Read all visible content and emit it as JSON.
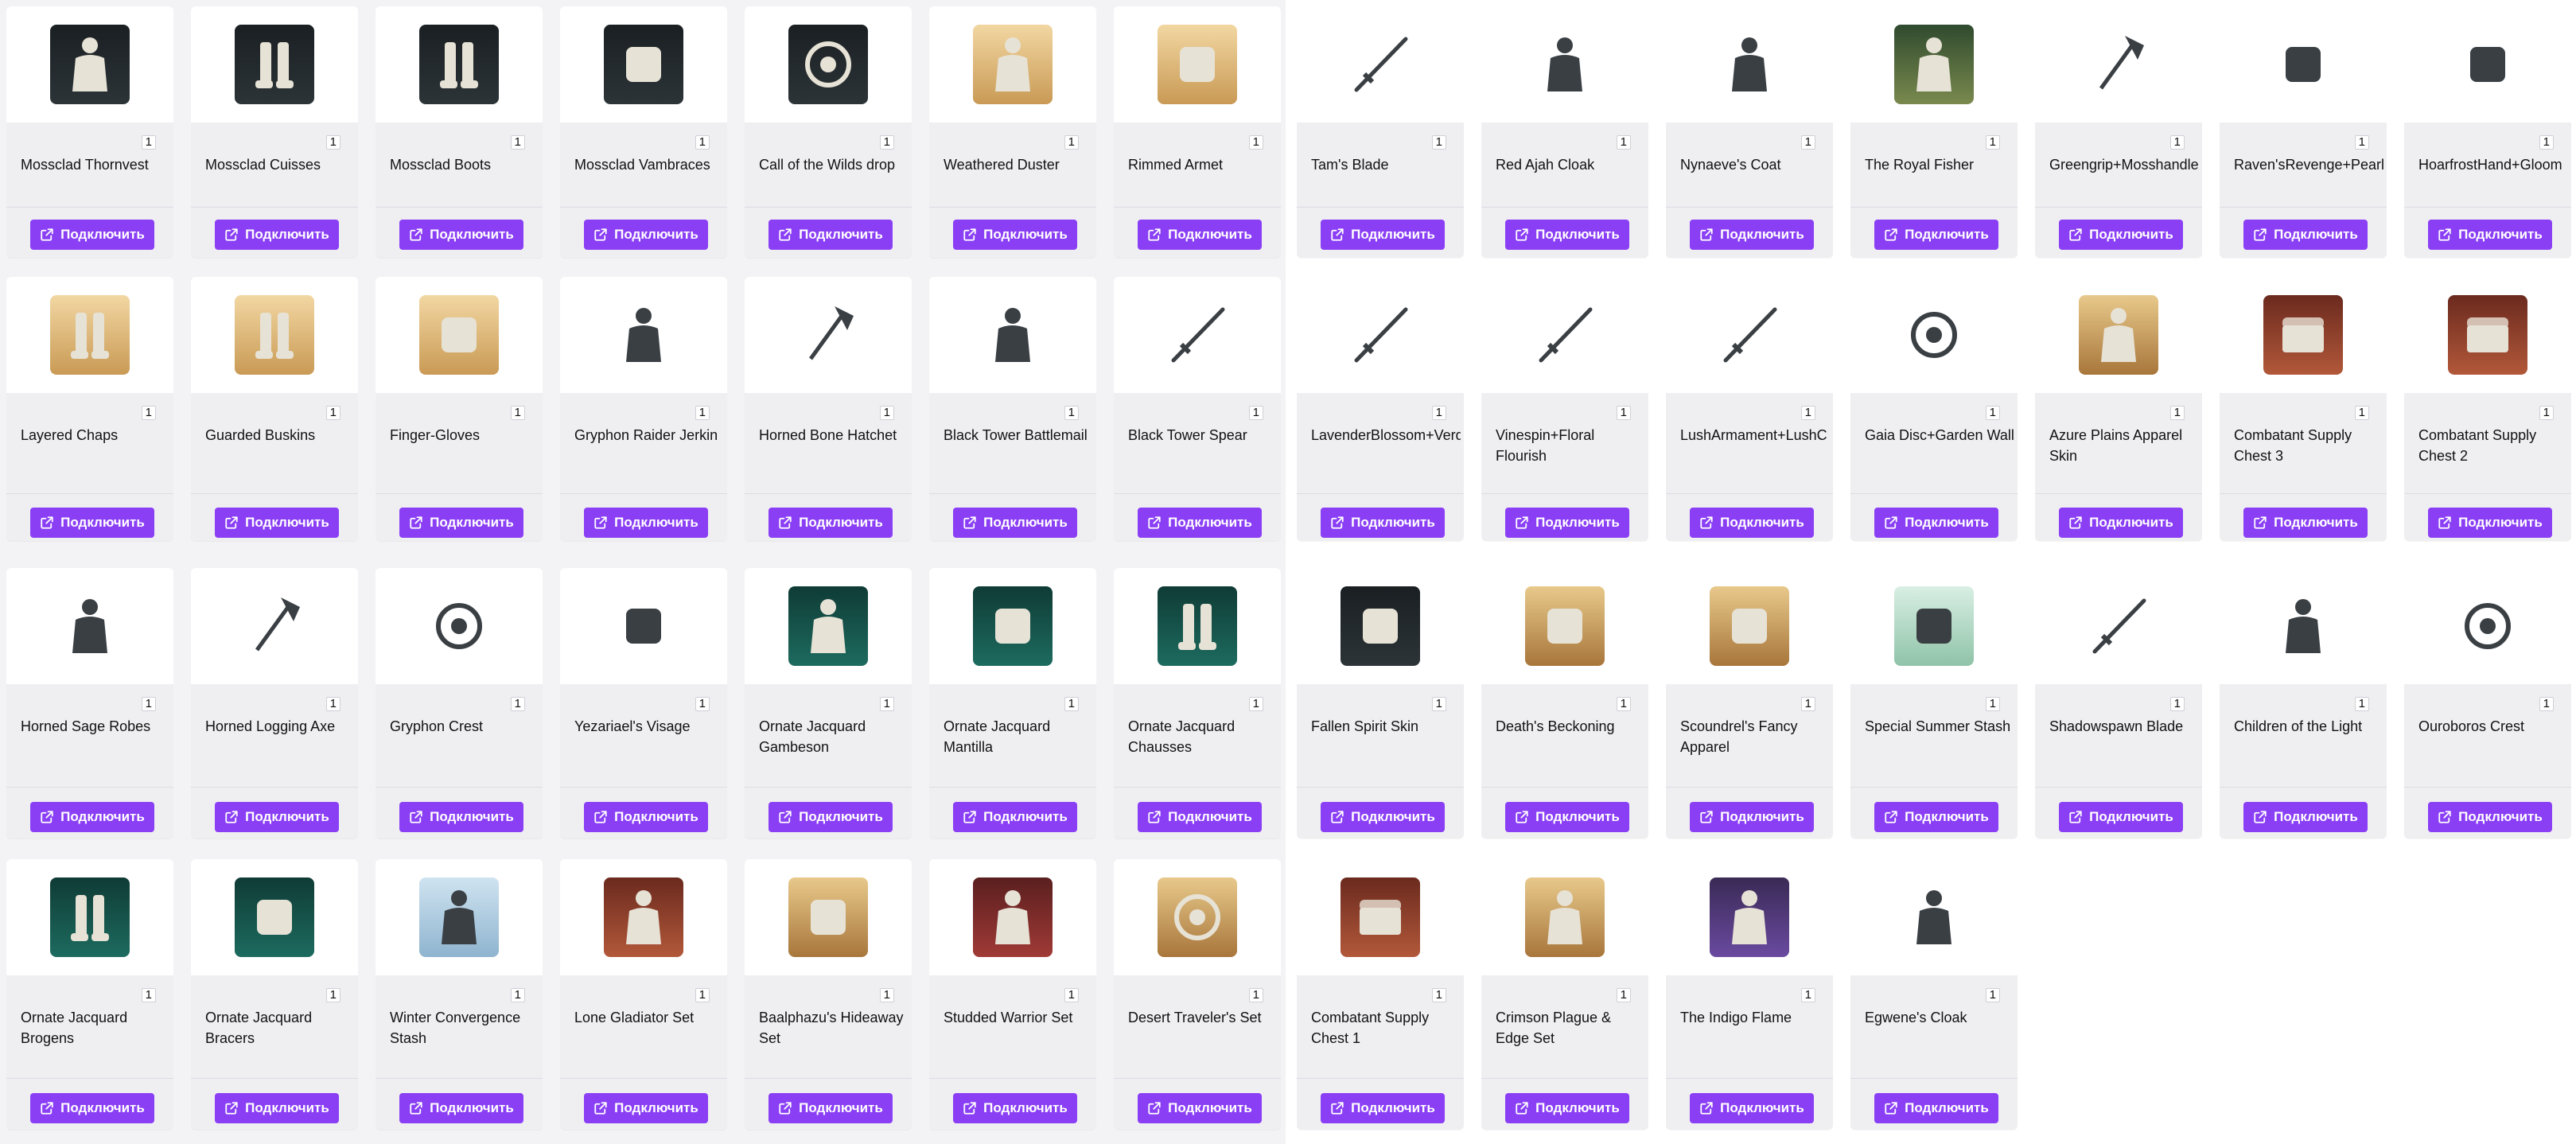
{
  "connect_label": "Подключить",
  "left_panel": {
    "rows": [
      [
        {
          "name": "Mossclad Thornvest",
          "qty": "1",
          "icon": "armor-vest-icon",
          "art": "dark"
        },
        {
          "name": "Mossclad Cuisses",
          "qty": "1",
          "icon": "leg-armor-icon",
          "art": "dark"
        },
        {
          "name": "Mossclad Boots",
          "qty": "1",
          "icon": "boots-icon",
          "art": "dark"
        },
        {
          "name": "Mossclad Vambraces",
          "qty": "1",
          "icon": "vambraces-icon",
          "art": "dark"
        },
        {
          "name": "Call of the Wilds drop",
          "qty": "1",
          "icon": "skull-emblem-icon",
          "art": "dark"
        },
        {
          "name": "Weathered Duster",
          "qty": "1",
          "icon": "coat-icon",
          "art": "desert"
        },
        {
          "name": "Rimmed Armet",
          "qty": "1",
          "icon": "helmet-icon",
          "art": "desert"
        }
      ],
      [
        {
          "name": "Layered Chaps",
          "qty": "1",
          "icon": "pants-icon",
          "art": "desert"
        },
        {
          "name": "Guarded Buskins",
          "qty": "1",
          "icon": "boots-icon",
          "art": "desert"
        },
        {
          "name": "Finger-Gloves",
          "qty": "1",
          "icon": "glove-icon",
          "art": "desert"
        },
        {
          "name": "Gryphon Raider Jerkin",
          "qty": "1",
          "icon": "character-icon",
          "art": "light"
        },
        {
          "name": "Horned Bone Hatchet",
          "qty": "1",
          "icon": "hatchet-icon",
          "art": "light"
        },
        {
          "name": "Black Tower Battlemail",
          "qty": "1",
          "icon": "character-icon",
          "art": "light"
        },
        {
          "name": "Black Tower Spear",
          "qty": "1",
          "icon": "spear-icon",
          "art": "light"
        }
      ],
      [
        {
          "name": "Horned Sage Robes",
          "qty": "1",
          "icon": "character-icon",
          "art": "light"
        },
        {
          "name": "Horned Logging Axe",
          "qty": "1",
          "icon": "axe-icon",
          "art": "light"
        },
        {
          "name": "Gryphon Crest",
          "qty": "1",
          "icon": "gryphon-crest-icon",
          "art": "light"
        },
        {
          "name": "Yezariael's Visage",
          "qty": "1",
          "icon": "mask-icon",
          "art": "light"
        },
        {
          "name": "Ornate Jacquard Gambeson",
          "qty": "1",
          "icon": "tunic-icon",
          "art": "teal"
        },
        {
          "name": "Ornate Jacquard Mantilla",
          "qty": "1",
          "icon": "hood-icon",
          "art": "teal"
        },
        {
          "name": "Ornate Jacquard Chausses",
          "qty": "1",
          "icon": "pants-icon",
          "art": "teal"
        }
      ],
      [
        {
          "name": "Ornate Jacquard Brogens",
          "qty": "1",
          "icon": "boots-icon",
          "art": "teal"
        },
        {
          "name": "Ornate Jacquard Bracers",
          "qty": "1",
          "icon": "bracers-icon",
          "art": "teal"
        },
        {
          "name": "Winter Convergence Stash",
          "qty": "1",
          "icon": "characters-icon",
          "art": "sky"
        },
        {
          "name": "Lone Gladiator Set",
          "qty": "1",
          "icon": "character-icon",
          "art": "rust"
        },
        {
          "name": "Baalphazu's Hideaway Set",
          "qty": "1",
          "icon": "tent-icon",
          "art": "sand"
        },
        {
          "name": "Studded Warrior Set",
          "qty": "1",
          "icon": "character-icon",
          "art": "red"
        },
        {
          "name": "Desert Traveler's Set",
          "qty": "1",
          "icon": "shield-icon",
          "art": "sand"
        }
      ]
    ]
  },
  "right_panel": {
    "rows": [
      [
        {
          "name": "Tam's Blade",
          "qty": "1",
          "icon": "sword-icon",
          "art": "light"
        },
        {
          "name": "Red Ajah Cloak",
          "qty": "1",
          "icon": "cloak-icon",
          "art": "light"
        },
        {
          "name": "Nynaeve's Coat",
          "qty": "1",
          "icon": "coat-icon",
          "art": "light"
        },
        {
          "name": "The Royal Fisher",
          "qty": "1",
          "icon": "character-icon",
          "art": "forest"
        },
        {
          "name": "Greengrip+Mosshandle",
          "qty": "1",
          "icon": "crossed-axes-icon",
          "art": "light"
        },
        {
          "name": "Raven'sRevenge+Pearl",
          "qty": "1",
          "icon": "crossed-staves-icon",
          "art": "light"
        },
        {
          "name": "HoarfrostHand+Gloom",
          "qty": "1",
          "icon": "gauntlet-gun-icon",
          "art": "light"
        }
      ],
      [
        {
          "name": "LavenderBlossom+Verd",
          "qty": "1",
          "icon": "sword-shield-icon",
          "art": "light"
        },
        {
          "name": "Vinespin+Floral Flourish",
          "qty": "1",
          "icon": "bow-spear-icon",
          "art": "light"
        },
        {
          "name": "LushArmament+LushC",
          "qty": "1",
          "icon": "axe-spear-icon",
          "art": "light"
        },
        {
          "name": "Gaia Disc+Garden Wall",
          "qty": "1",
          "icon": "shield-icon",
          "art": "light"
        },
        {
          "name": "Azure Plains Apparel Skin",
          "qty": "1",
          "icon": "outfit-icon",
          "art": "sand"
        },
        {
          "name": "Combatant Supply Chest 3",
          "qty": "1",
          "icon": "chest-icon",
          "art": "rust"
        },
        {
          "name": "Combatant Supply Chest 2",
          "qty": "1",
          "icon": "chest-icon",
          "art": "rust"
        }
      ],
      [
        {
          "name": "Fallen Spirit Skin",
          "qty": "1",
          "icon": "armor-set-icon",
          "art": "dark"
        },
        {
          "name": "Death's Beckoning",
          "qty": "1",
          "icon": "armor-set-icon",
          "art": "sand"
        },
        {
          "name": "Scoundrel's Fancy Apparel",
          "qty": "1",
          "icon": "armor-set-icon",
          "art": "sand"
        },
        {
          "name": "Special Summer Stash",
          "qty": "1",
          "icon": "instruments-icon",
          "art": "mint"
        },
        {
          "name": "Shadowspawn Blade",
          "qty": "1",
          "icon": "sword-icon",
          "art": "light"
        },
        {
          "name": "Children of the Light",
          "qty": "1",
          "icon": "robe-icon",
          "art": "light"
        },
        {
          "name": "Ouroboros Crest",
          "qty": "1",
          "icon": "ring-crest-icon",
          "art": "light"
        }
      ],
      [
        {
          "name": "Combatant Supply Chest 1",
          "qty": "1",
          "icon": "chest-icon",
          "art": "rust"
        },
        {
          "name": "Crimson Plague & Edge Set",
          "qty": "1",
          "icon": "rider-icon",
          "art": "sand"
        },
        {
          "name": "The Indigo Flame",
          "qty": "1",
          "icon": "character-icon",
          "art": "indigo"
        },
        {
          "name": "Egwene's Cloak",
          "qty": "1",
          "icon": "cloak-icon",
          "art": "light"
        }
      ]
    ]
  }
}
